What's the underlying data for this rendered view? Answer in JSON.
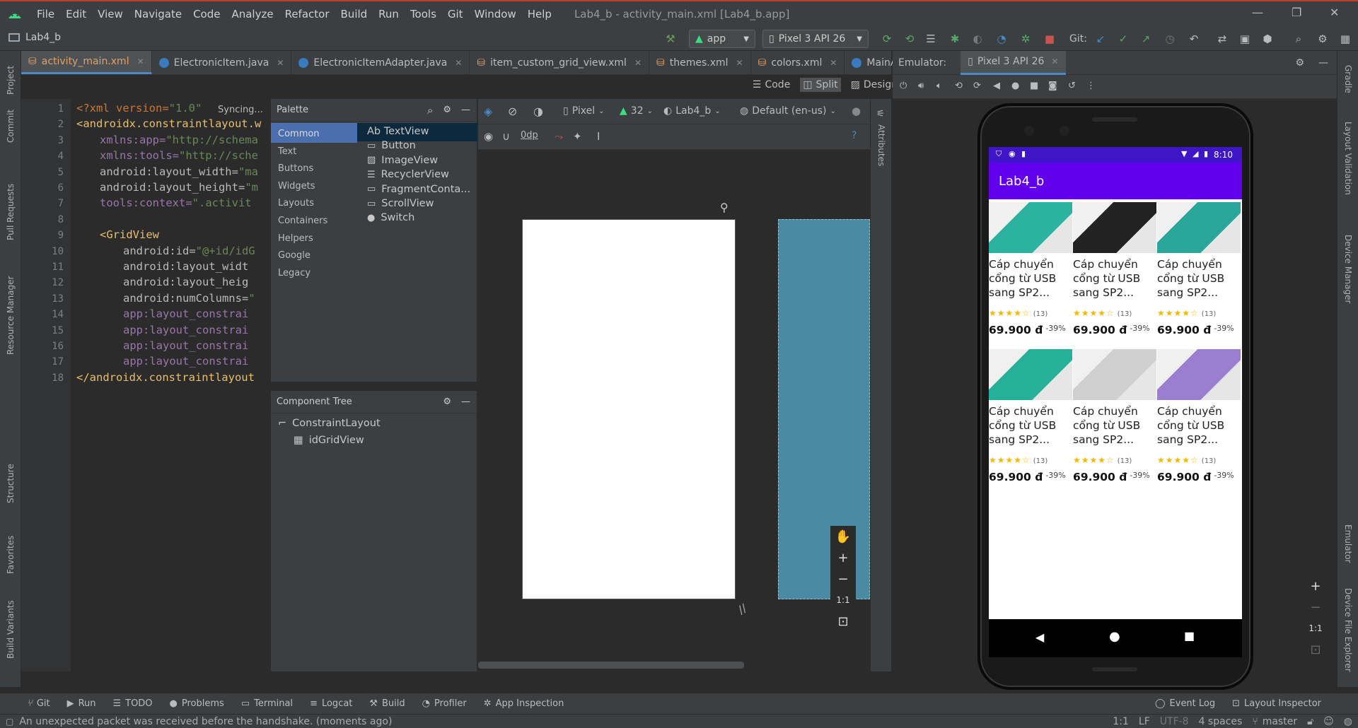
{
  "menu": [
    "File",
    "Edit",
    "View",
    "Navigate",
    "Code",
    "Analyze",
    "Refactor",
    "Build",
    "Run",
    "Tools",
    "Git",
    "Window",
    "Help"
  ],
  "window_title": "Lab4_b - activity_main.xml [Lab4_b.app]",
  "toolbar": {
    "project": "Lab4_b",
    "run_config": "app",
    "device": "Pixel 3 API 26",
    "git_label": "Git:"
  },
  "tabs": [
    {
      "label": "activity_main.xml"
    },
    {
      "label": "ElectronicItem.java"
    },
    {
      "label": "ElectronicItemAdapter.java"
    },
    {
      "label": "item_custom_grid_view.xml"
    },
    {
      "label": "themes.xml"
    },
    {
      "label": "colors.xml"
    },
    {
      "label": "MainA"
    }
  ],
  "editor_modes": {
    "code": "Code",
    "split": "Split",
    "design": "Design"
  },
  "left_strip": [
    "Project",
    "Commit",
    "Pull Requests",
    "Resource Manager",
    "Structure",
    "Favorites",
    "Build Variants"
  ],
  "right_strip": [
    "Gradle",
    "Layout Validation",
    "Device Manager",
    "Emulator",
    "Device File Explorer"
  ],
  "code": {
    "status": "Syncing...",
    "line_numbers": [
      "1",
      "2",
      "3",
      "4",
      "5",
      "6",
      "7",
      "8",
      "9",
      "10",
      "11",
      "12",
      "13",
      "14",
      "15",
      "16",
      "17",
      "18"
    ],
    "lines": [
      {
        "a": "<?xml version=",
        "b": "\"1.0\""
      },
      {
        "a": "<androidx.constraintlayout.w",
        "b": ""
      },
      {
        "a": "xmlns:app=",
        "b": "\"http://schema"
      },
      {
        "a": "xmlns:tools=",
        "b": "\"http://sche"
      },
      {
        "a": "android:layout_width=",
        "b": "\"ma"
      },
      {
        "a": "android:layout_height=",
        "b": "\"m"
      },
      {
        "a": "tools:context=",
        "b": "\".activit"
      },
      {
        "a": "",
        "b": ""
      },
      {
        "a": "<GridView",
        "b": ""
      },
      {
        "a": "android:id=",
        "b": "\"@+id/idG"
      },
      {
        "a": "android:layout_widt",
        "b": ""
      },
      {
        "a": "android:layout_heig",
        "b": ""
      },
      {
        "a": "android:numColumns=",
        "b": "\""
      },
      {
        "a": "app:layout_constrai",
        "b": ""
      },
      {
        "a": "app:layout_constrai",
        "b": ""
      },
      {
        "a": "app:layout_constrai",
        "b": ""
      },
      {
        "a": "app:layout_constrai",
        "b": ""
      },
      {
        "a": "</androidx.constraintlayout",
        "b": ""
      }
    ]
  },
  "palette": {
    "title": "Palette",
    "categories": [
      "Common",
      "Text",
      "Buttons",
      "Widgets",
      "Layouts",
      "Containers",
      "Helpers",
      "Google",
      "Legacy"
    ],
    "items": [
      "Ab TextView",
      "Button",
      "ImageView",
      "RecyclerView",
      "FragmentConta...",
      "ScrollView",
      "Switch"
    ]
  },
  "component_tree": {
    "title": "Component Tree",
    "root": "ConstraintLayout",
    "child": "idGridView"
  },
  "design_toolbar": {
    "device": "Pixel",
    "api": "32",
    "theme": "Lab4_b",
    "locale": "Default (en-us)",
    "margin": "0dp"
  },
  "design_zoom": {
    "fit": "1:1"
  },
  "emulator": {
    "label": "Emulator:",
    "device_tab": "Pixel 3 API 26",
    "fit": "1:1"
  },
  "phone": {
    "time": "8:10",
    "app_title": "Lab4_b",
    "products": [
      {
        "name": "Cáp chuyển cổng từ USB sang SP2...",
        "stars": "★★★★☆",
        "count": "(13)",
        "price": "69.900 đ",
        "discount": "-39%",
        "color": "#2bb3a0"
      },
      {
        "name": "Cáp chuyển cổng từ USB sang SP2...",
        "stars": "★★★★☆",
        "count": "(13)",
        "price": "69.900 đ",
        "discount": "-39%",
        "color": "#222222"
      },
      {
        "name": "Cáp chuyển cổng từ USB sang SP2...",
        "stars": "★★★★☆",
        "count": "(13)",
        "price": "69.900 đ",
        "discount": "-39%",
        "color": "#2ba69a"
      },
      {
        "name": "Cáp chuyển cổng từ USB sang SP2...",
        "stars": "★★★★☆",
        "count": "(13)",
        "price": "69.900 đ",
        "discount": "-39%",
        "color": "#25b09a"
      },
      {
        "name": "Cáp chuyển cổng từ USB sang SP2...",
        "stars": "★★★★☆",
        "count": "(13)",
        "price": "69.900 đ",
        "discount": "-39%",
        "color": "#cfcfcf"
      },
      {
        "name": "Cáp chuyển cổng từ USB sang SP2...",
        "stars": "★★★★☆",
        "count": "(13)",
        "price": "69.900 đ",
        "discount": "-39%",
        "color": "#9a7fd0"
      }
    ]
  },
  "bottom_tools": [
    "Git",
    "Run",
    "TODO",
    "Problems",
    "Terminal",
    "Logcat",
    "Build",
    "Profiler",
    "App Inspection"
  ],
  "bottom_right": [
    "Event Log",
    "Layout Inspector"
  ],
  "status": {
    "message": "An unexpected packet was received before the handshake. (moments ago)",
    "position": "1:1",
    "line_sep": "LF",
    "encoding": "UTF-8",
    "indent": "4 spaces",
    "branch": "master"
  }
}
